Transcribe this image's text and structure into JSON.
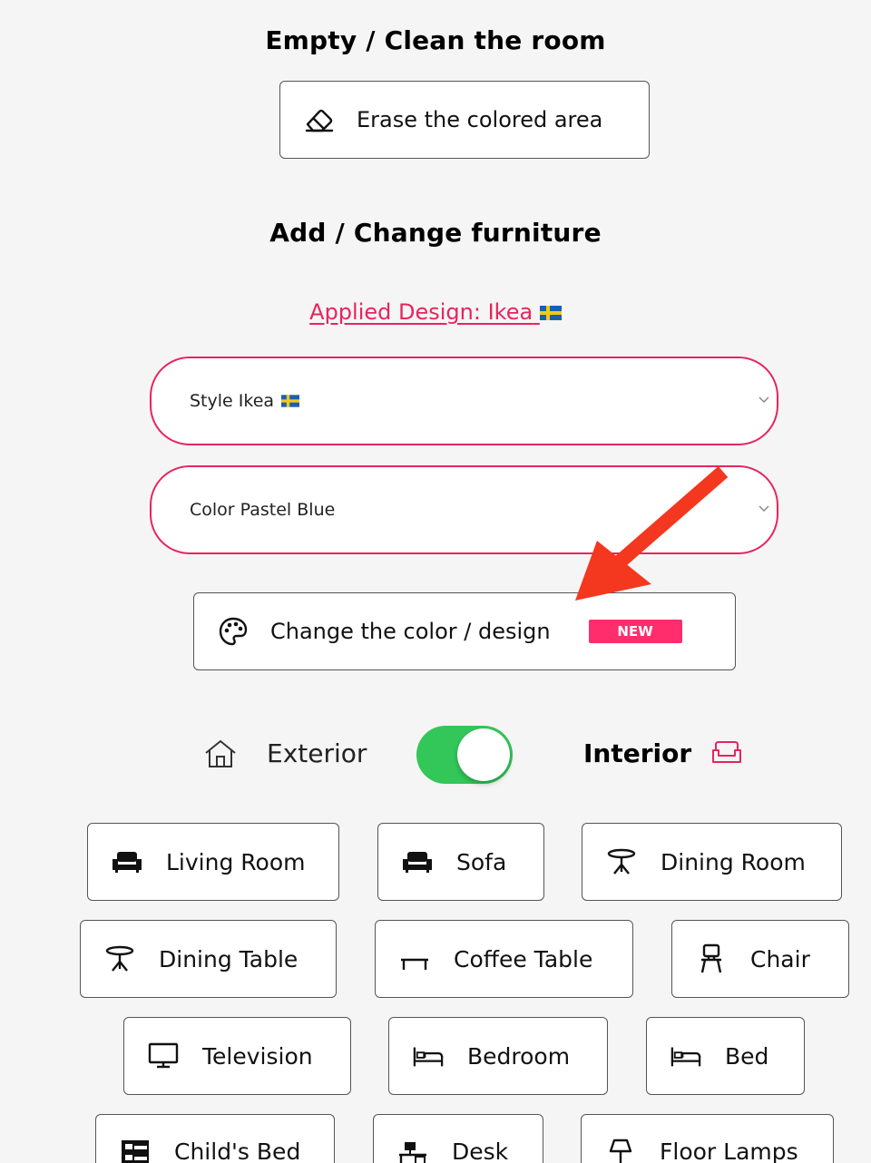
{
  "sections": {
    "empty_heading": "Empty / Clean the room",
    "erase_button": "Erase the colored area",
    "furniture_heading": "Add / Change furniture"
  },
  "applied_design": {
    "text": "Applied Design: Ikea",
    "flag": "sweden-flag"
  },
  "selects": {
    "style": {
      "value": "Style Ikea",
      "flag": "sweden-flag"
    },
    "color": {
      "value": "Color Pastel Blue"
    }
  },
  "change_design": {
    "label": "Change the color / design",
    "badge": "NEW"
  },
  "mode_toggle": {
    "left_label": "Exterior",
    "right_label": "Interior",
    "selected": "Interior",
    "on_color": "#33c759"
  },
  "categories": [
    {
      "label": "Living Room",
      "icon": "sofa-icon"
    },
    {
      "label": "Sofa",
      "icon": "sofa-icon"
    },
    {
      "label": "Dining Room",
      "icon": "round-table-icon"
    },
    {
      "label": "Dining Table",
      "icon": "round-table-icon"
    },
    {
      "label": "Coffee Table",
      "icon": "coffee-table-icon"
    },
    {
      "label": "Chair",
      "icon": "chair-icon"
    },
    {
      "label": "Television",
      "icon": "tv-icon"
    },
    {
      "label": "Bedroom",
      "icon": "bed-icon"
    },
    {
      "label": "Bed",
      "icon": "bed-icon"
    },
    {
      "label": "Child's Bed",
      "icon": "bunk-bed-icon"
    },
    {
      "label": "Desk",
      "icon": "desk-icon"
    },
    {
      "label": "Floor Lamps",
      "icon": "floor-lamp-icon"
    }
  ],
  "colors": {
    "accent": "#e8245e",
    "badge": "#ff2d6c",
    "annotation_arrow": "#f4371f"
  }
}
